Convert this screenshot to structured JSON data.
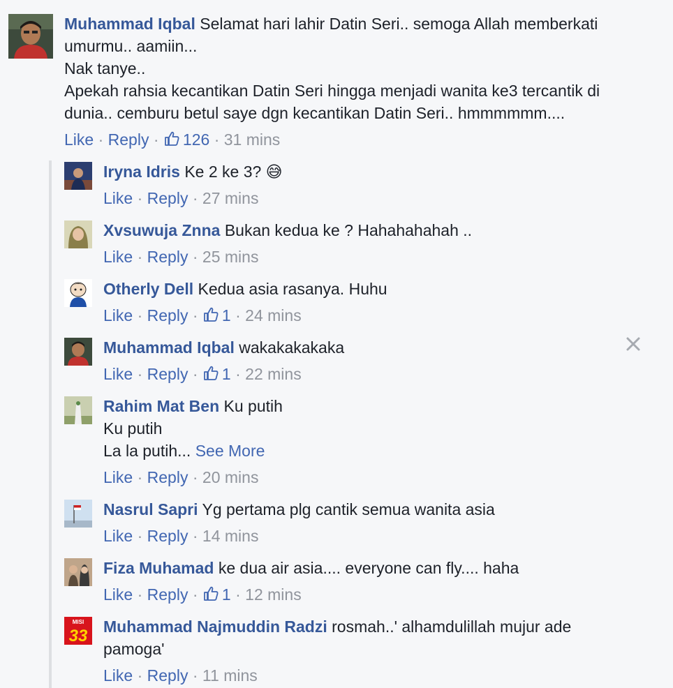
{
  "actions": {
    "like": "Like",
    "reply": "Reply",
    "see_more": "See More",
    "dot": "·"
  },
  "top_comment": {
    "author": "Muhammad Iqbal",
    "lines": [
      "Selamat hari lahir Datin Seri.. semoga Allah memberkati",
      "umurmu.. aamiin...",
      "Nak tanye..",
      "Apekah rahsia kecantikan Datin Seri hingga menjadi wanita ke3 tercantik di",
      "dunia.. cemburu betul saye dgn kecantikan Datin Seri.. hmmmmmm...."
    ],
    "likes": "126",
    "time": "31 mins"
  },
  "replies": [
    {
      "author": "Iryna Idris",
      "lines": [
        "Ke 2 ke 3? 😅"
      ],
      "likes": "",
      "time": "27 mins"
    },
    {
      "author": "Xvsuwuja Znna",
      "lines": [
        "Bukan kedua ke ? Hahahahahah .."
      ],
      "likes": "",
      "time": "25 mins"
    },
    {
      "author": "Otherly Dell",
      "lines": [
        "Kedua asia rasanya. Huhu"
      ],
      "likes": "1",
      "time": "24 mins"
    },
    {
      "author": "Muhammad Iqbal",
      "lines": [
        "wakakakakaka"
      ],
      "likes": "1",
      "time": "22 mins"
    },
    {
      "author": "Rahim Mat Ben",
      "lines": [
        "Ku putih",
        "Ku putih",
        "La la putih..."
      ],
      "likes": "",
      "time": "20 mins"
    },
    {
      "author": "Nasrul Sapri",
      "lines": [
        "Yg pertama plg cantik semua wanita asia"
      ],
      "likes": "",
      "time": "14 mins"
    },
    {
      "author": "Fiza Muhamad",
      "lines": [
        "ke dua air asia.... everyone can fly.... haha"
      ],
      "likes": "1",
      "time": "12 mins"
    },
    {
      "author": "Muhammad Najmuddin Radzi",
      "lines": [
        "rosmah..' alhamdulillah mujur ade",
        "pamoga'"
      ],
      "likes": "",
      "time": "11 mins"
    }
  ],
  "avatar_text": {
    "misi": "MISI",
    "number": "33"
  },
  "colors": {
    "name": "#365899",
    "link": "#4267b2",
    "meta": "#90949c",
    "background": "#f6f7f9"
  }
}
